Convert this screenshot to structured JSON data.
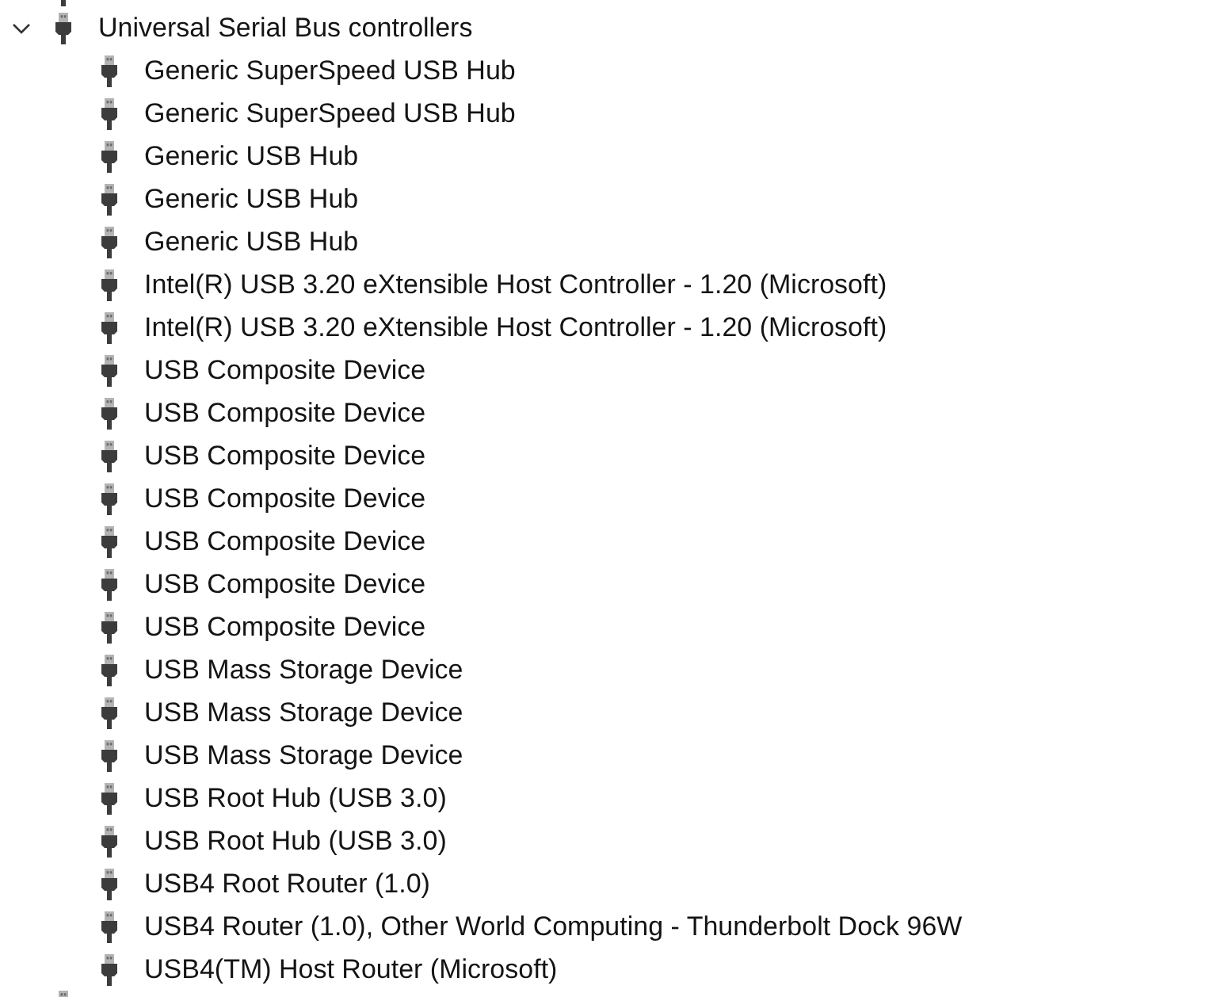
{
  "tree": {
    "label": "Universal Serial Bus controllers",
    "expanded": true,
    "children": [
      {
        "label": "Generic SuperSpeed USB Hub"
      },
      {
        "label": "Generic SuperSpeed USB Hub"
      },
      {
        "label": "Generic USB Hub"
      },
      {
        "label": "Generic USB Hub"
      },
      {
        "label": "Generic USB Hub"
      },
      {
        "label": "Intel(R) USB 3.20 eXtensible Host Controller - 1.20 (Microsoft)"
      },
      {
        "label": "Intel(R) USB 3.20 eXtensible Host Controller - 1.20 (Microsoft)"
      },
      {
        "label": "USB Composite Device"
      },
      {
        "label": "USB Composite Device"
      },
      {
        "label": "USB Composite Device"
      },
      {
        "label": "USB Composite Device"
      },
      {
        "label": "USB Composite Device"
      },
      {
        "label": "USB Composite Device"
      },
      {
        "label": "USB Composite Device"
      },
      {
        "label": "USB Mass Storage Device"
      },
      {
        "label": "USB Mass Storage Device"
      },
      {
        "label": "USB Mass Storage Device"
      },
      {
        "label": "USB Root Hub (USB 3.0)"
      },
      {
        "label": "USB Root Hub (USB 3.0)"
      },
      {
        "label": "USB4 Root Router (1.0)"
      },
      {
        "label": "USB4 Router (1.0), Other World Computing - Thunderbolt Dock 96W"
      },
      {
        "label": "USB4(TM) Host Router (Microsoft)"
      }
    ]
  }
}
